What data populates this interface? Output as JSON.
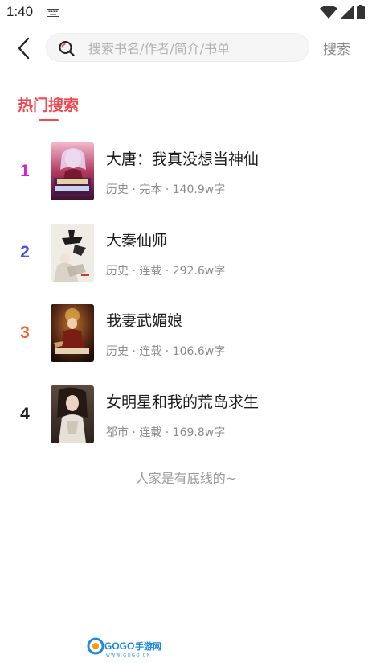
{
  "status_bar": {
    "time": "1:40",
    "keyboard_icon": "keyboard-icon",
    "wifi_icon": "wifi-icon",
    "signal_icon": "signal-icon",
    "battery_icon": "battery-icon"
  },
  "top_bar": {
    "back_icon": "chevron-left-icon",
    "search_icon": "search-icon",
    "search_placeholder": "搜索书名/作者/简介/书单",
    "search_value": "",
    "search_button": "搜索"
  },
  "section": {
    "title": "热门搜索",
    "accent_color": "#ef4a4f"
  },
  "books": [
    {
      "rank": "1",
      "rank_color": "#d51ed8",
      "title": "大唐：我真没想当神仙",
      "meta": "历史 · 完本 · 140.9w字"
    },
    {
      "rank": "2",
      "rank_color": "#4d52e0",
      "title": "大秦仙师",
      "meta": "历史 · 连载 · 292.6w字"
    },
    {
      "rank": "3",
      "rank_color": "#f0662a",
      "title": "我妻武媚娘",
      "meta": "历史 · 连载 · 106.6w字"
    },
    {
      "rank": "4",
      "rank_color": "#1e1e1e",
      "title": "女明星和我的荒岛求生",
      "meta": "都市 · 连载 · 169.8w字"
    }
  ],
  "footer_note": "人家是有底线的~",
  "watermark": {
    "logo": "GOGO手游网",
    "site": "WWW.GOGO.CN"
  }
}
